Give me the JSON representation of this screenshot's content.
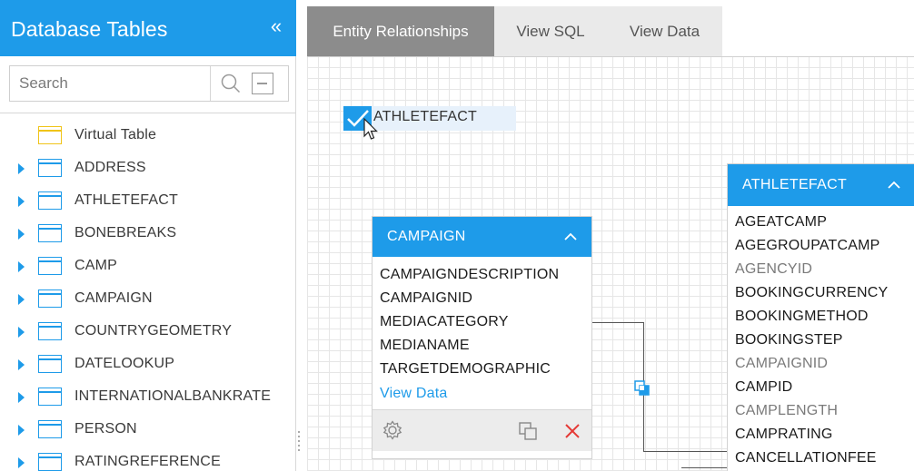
{
  "left_panel": {
    "title": "Database Tables",
    "collapse_glyph": "«",
    "search_placeholder": "Search",
    "items": [
      {
        "label": "Virtual Table",
        "expandable": false,
        "icon": "virtual-table-icon"
      },
      {
        "label": "ADDRESS",
        "expandable": true,
        "icon": "table-icon"
      },
      {
        "label": "ATHLETEFACT",
        "expandable": true,
        "icon": "table-icon"
      },
      {
        "label": "BONEBREAKS",
        "expandable": true,
        "icon": "table-icon"
      },
      {
        "label": "CAMP",
        "expandable": true,
        "icon": "table-icon"
      },
      {
        "label": "CAMPAIGN",
        "expandable": true,
        "icon": "table-icon"
      },
      {
        "label": "COUNTRYGEOMETRY",
        "expandable": true,
        "icon": "table-icon"
      },
      {
        "label": "DATELOOKUP",
        "expandable": true,
        "icon": "table-icon"
      },
      {
        "label": "INTERNATIONALBANKRATE",
        "expandable": true,
        "icon": "table-icon"
      },
      {
        "label": "PERSON",
        "expandable": true,
        "icon": "table-icon"
      },
      {
        "label": "RATINGREFERENCE",
        "expandable": true,
        "icon": "table-icon"
      }
    ]
  },
  "tabs": [
    {
      "label": "Entity Relationships",
      "active": true
    },
    {
      "label": "View SQL",
      "active": false
    },
    {
      "label": "View Data",
      "active": false
    }
  ],
  "canvas": {
    "selected_table": {
      "label": "ATHLETEFACT",
      "checked": true
    },
    "entities": {
      "campaign": {
        "title": "CAMPAIGN",
        "fields": [
          {
            "name": "CAMPAIGNDESCRIPTION",
            "style": "pk"
          },
          {
            "name": "CAMPAIGNID",
            "style": "pk"
          },
          {
            "name": "MEDIACATEGORY",
            "style": "pk"
          },
          {
            "name": "MEDIANAME",
            "style": "pk"
          },
          {
            "name": "TARGETDEMOGRAPHIC",
            "style": "pk"
          }
        ],
        "view_data": "View Data",
        "footer_icons": [
          "settings-icon",
          "duplicate-icon",
          "delete-icon"
        ]
      },
      "athletefact": {
        "title": "ATHLETEFACT",
        "fields": [
          {
            "name": "AGEATCAMP",
            "style": "pk"
          },
          {
            "name": "AGEGROUPATCAMP",
            "style": "pk"
          },
          {
            "name": "AGENCYID",
            "style": "light"
          },
          {
            "name": "BOOKINGCURRENCY",
            "style": "pk"
          },
          {
            "name": "BOOKINGMETHOD",
            "style": "pk"
          },
          {
            "name": "BOOKINGSTEP",
            "style": "pk"
          },
          {
            "name": "CAMPAIGNID",
            "style": "light"
          },
          {
            "name": "CAMPID",
            "style": "pk"
          },
          {
            "name": "CAMPLENGTH",
            "style": "light"
          },
          {
            "name": "CAMPRATING",
            "style": "pk"
          },
          {
            "name": "CANCELLATIONFEE",
            "style": "pk"
          }
        ]
      }
    }
  },
  "colors": {
    "accent": "#1e9be9",
    "tab_active": "#8c8c8c",
    "tab_inactive": "#eaeaea",
    "delete": "#e53935",
    "virtual_icon": "#f0c419"
  }
}
